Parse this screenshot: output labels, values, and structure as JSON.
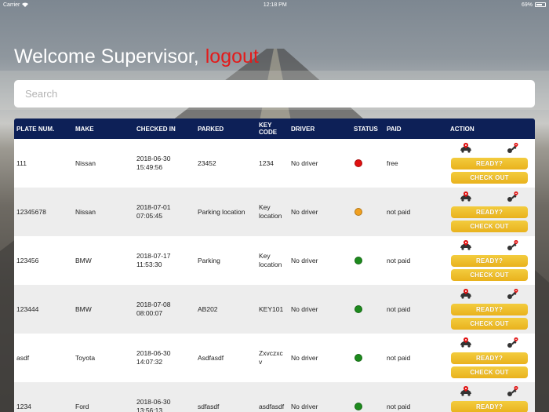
{
  "statusbar": {
    "carrier": "Carrier",
    "time": "12:18 PM",
    "battery": "69%",
    "battery_level": 0.69
  },
  "header": {
    "welcome": "Welcome Supervisor,",
    "logout": "logout"
  },
  "search": {
    "placeholder": "Search"
  },
  "table": {
    "columns": {
      "plate": "PLATE NUM.",
      "make": "MAKE",
      "checked_in": "CHECKED IN",
      "parked": "PARKED",
      "key_line1": "KEY",
      "key_line2": "CODE",
      "driver": "DRIVER",
      "status": "STATUS",
      "paid": "PAID",
      "action": "ACTION"
    },
    "actions": {
      "ready": "READY?",
      "checkout": "CHECK OUT"
    },
    "status_colors": {
      "red": "#e01010",
      "orange": "#f0a020",
      "green": "#1d8a1d"
    },
    "rows": [
      {
        "plate": "111",
        "make": "Nissan",
        "date": "2018-06-30",
        "time": "15:49:56",
        "parked": "23452",
        "key1": "1234",
        "key2": "",
        "driver": "No driver",
        "status": "red",
        "paid": "free"
      },
      {
        "plate": "12345678",
        "make": "Nissan",
        "date": "2018-07-01",
        "time": "07:05:45",
        "parked": "Parking location",
        "key1": "Key",
        "key2": "location",
        "driver": "No driver",
        "status": "orange",
        "paid": "not paid"
      },
      {
        "plate": "123456",
        "make": "BMW",
        "date": "2018-07-17",
        "time": "11:53:30",
        "parked": "Parking",
        "key1": "Key",
        "key2": "location",
        "driver": "No driver",
        "status": "green",
        "paid": "not paid"
      },
      {
        "plate": "123444",
        "make": "BMW",
        "date": "2018-07-08",
        "time": "08:00:07",
        "parked": "AB202",
        "key1": "KEY101",
        "key2": "",
        "driver": "No driver",
        "status": "green",
        "paid": "not paid"
      },
      {
        "plate": "asdf",
        "make": "Toyota",
        "date": "2018-06-30",
        "time": "14:07:32",
        "parked": "Asdfasdf",
        "key1": "Zxvczxc",
        "key2": "v",
        "driver": "No driver",
        "status": "green",
        "paid": "not paid"
      },
      {
        "plate": "1234",
        "make": "Ford",
        "date": "2018-06-30",
        "time": "13:56:13",
        "parked": "sdfasdf",
        "key1": "asdfasdf",
        "key2": "",
        "driver": "No driver",
        "status": "green",
        "paid": "not paid"
      }
    ]
  }
}
